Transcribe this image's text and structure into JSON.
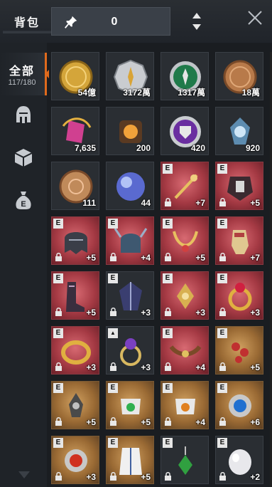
{
  "header": {
    "title": "背包",
    "pinned_count": "0"
  },
  "sidebar": {
    "all_label": "全部",
    "all_count": "117/180",
    "categories": [
      "helmet-icon",
      "box-icon",
      "money-bag-icon"
    ]
  },
  "items": [
    {
      "icon": "gold-coin-icon",
      "qty": "54億"
    },
    {
      "icon": "silver-compass-coin-icon",
      "qty": "3172萬"
    },
    {
      "icon": "green-emblem-coin-icon",
      "qty": "1317萬"
    },
    {
      "icon": "bronze-coin-icon",
      "qty": "18萬"
    },
    {
      "icon": "pink-crystal-icon",
      "qty": "7,635"
    },
    {
      "icon": "fire-orb-icon",
      "qty": "200"
    },
    {
      "icon": "purple-shield-coin-icon",
      "qty": "420"
    },
    {
      "icon": "blue-essence-icon",
      "qty": "920"
    },
    {
      "icon": "copper-coin-icon",
      "qty": "111"
    },
    {
      "icon": "crystal-orb-icon",
      "qty": "44"
    },
    {
      "icon": "golden-bow-icon",
      "grade": "E",
      "qty": "+7"
    },
    {
      "icon": "demon-armor-icon",
      "grade": "E",
      "qty": "+5"
    },
    {
      "icon": "dark-helmet-icon",
      "grade": "E",
      "qty": "+5"
    },
    {
      "icon": "horned-helmet-icon",
      "grade": "E",
      "qty": "+4"
    },
    {
      "icon": "golden-necklace-icon",
      "grade": "E",
      "qty": "+5"
    },
    {
      "icon": "gauntlet-icon",
      "grade": "E",
      "qty": "+7"
    },
    {
      "icon": "armored-boots-icon",
      "grade": "E",
      "qty": "+5"
    },
    {
      "icon": "dark-cloak-icon",
      "grade": "E",
      "qty": "+3"
    },
    {
      "icon": "gold-pendant-icon",
      "grade": "E",
      "qty": "+3"
    },
    {
      "icon": "ruby-ring-icon",
      "grade": "E",
      "qty": "+3"
    },
    {
      "icon": "gold-ring-icon",
      "grade": "E",
      "qty": "+3"
    },
    {
      "icon": "amethyst-ring-icon",
      "grade": "helmet-badge",
      "qty": "+3"
    },
    {
      "icon": "choker-icon",
      "grade": "E",
      "qty": "+4"
    },
    {
      "icon": "ruby-chain-icon",
      "grade": "E",
      "qty": "+5"
    },
    {
      "icon": "ornate-earring-icon",
      "grade": "E",
      "qty": "+5"
    },
    {
      "icon": "green-gem-bracer-icon",
      "grade": "E",
      "qty": "+5"
    },
    {
      "icon": "orange-gem-bracer-icon",
      "grade": "E",
      "qty": "+4"
    },
    {
      "icon": "blue-gem-amulet-icon",
      "grade": "E",
      "qty": "+6"
    },
    {
      "icon": "red-gem-amulet-icon",
      "grade": "E",
      "qty": "+3"
    },
    {
      "icon": "white-robe-icon",
      "grade": "E",
      "qty": "+5"
    },
    {
      "icon": "emerald-earring-icon",
      "grade": "E",
      "qty": ""
    },
    {
      "icon": "moonstone-icon",
      "grade": "E",
      "qty": "+2"
    }
  ],
  "colors": {
    "accent": "#e06a1c",
    "panel": "#1a1d21",
    "slot_red": "#a53a44",
    "slot_gold": "#9a6a34"
  }
}
